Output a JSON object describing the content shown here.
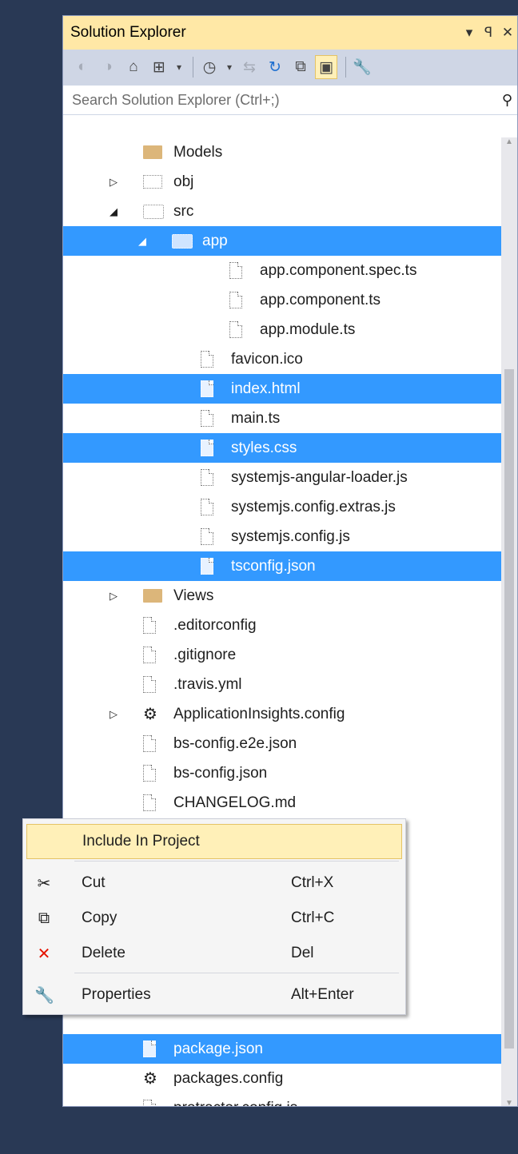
{
  "window": {
    "title": "Solution Explorer",
    "dropdown_glyph": "▾",
    "pin_glyph": "ꟼ",
    "close_glyph": "✕"
  },
  "toolbar": {
    "icons": [
      "back-icon",
      "forward-icon",
      "home-icon",
      "switch-views-icon",
      "dropdown-icon",
      "pending-changes-filter-icon",
      "dropdown-icon",
      "sync-with-active-document-icon",
      "refresh-icon",
      "collapse-all-icon",
      "show-all-files-icon",
      "properties-icon"
    ]
  },
  "search": {
    "placeholder": "Search Solution Explorer (Ctrl+;)"
  },
  "tree": {
    "rows": [
      {
        "label": "Models",
        "icon": "folder-icon",
        "arrow": "",
        "level": 2,
        "selected": false
      },
      {
        "label": "obj",
        "icon": "folder-excluded-icon",
        "arrow": "▷",
        "level": 2,
        "selected": false
      },
      {
        "label": "src",
        "icon": "folder-open-excluded-icon",
        "arrow": "◢",
        "level": 2,
        "selected": false
      },
      {
        "label": "app",
        "icon": "folder-open-excluded-icon",
        "arrow": "◢",
        "level": 3,
        "selected": true
      },
      {
        "label": "app.component.spec.ts",
        "icon": "file-excluded-icon",
        "arrow": "",
        "level": 5,
        "selected": false
      },
      {
        "label": "app.component.ts",
        "icon": "file-excluded-icon",
        "arrow": "",
        "level": 5,
        "selected": false
      },
      {
        "label": "app.module.ts",
        "icon": "file-excluded-icon",
        "arrow": "",
        "level": 5,
        "selected": false
      },
      {
        "label": "favicon.ico",
        "icon": "file-excluded-icon",
        "arrow": "",
        "level": 4,
        "selected": false
      },
      {
        "label": "index.html",
        "icon": "file-excluded-icon",
        "arrow": "",
        "level": 4,
        "selected": true
      },
      {
        "label": "main.ts",
        "icon": "file-excluded-icon",
        "arrow": "",
        "level": 4,
        "selected": false
      },
      {
        "label": "styles.css",
        "icon": "file-excluded-icon",
        "arrow": "",
        "level": 4,
        "selected": true
      },
      {
        "label": "systemjs-angular-loader.js",
        "icon": "file-excluded-icon",
        "arrow": "",
        "level": 4,
        "selected": false
      },
      {
        "label": "systemjs.config.extras.js",
        "icon": "file-excluded-icon",
        "arrow": "",
        "level": 4,
        "selected": false
      },
      {
        "label": "systemjs.config.js",
        "icon": "file-excluded-icon",
        "arrow": "",
        "level": 4,
        "selected": false
      },
      {
        "label": "tsconfig.json",
        "icon": "file-excluded-icon",
        "arrow": "",
        "level": 4,
        "selected": true
      },
      {
        "label": "Views",
        "icon": "folder-icon",
        "arrow": "▷",
        "level": 2,
        "selected": false
      },
      {
        "label": ".editorconfig",
        "icon": "file-excluded-icon",
        "arrow": "",
        "level": 2,
        "selected": false
      },
      {
        "label": ".gitignore",
        "icon": "file-excluded-icon",
        "arrow": "",
        "level": 2,
        "selected": false
      },
      {
        "label": ".travis.yml",
        "icon": "file-excluded-icon",
        "arrow": "",
        "level": 2,
        "selected": false
      },
      {
        "label": "ApplicationInsights.config",
        "icon": "config-file-icon",
        "arrow": "▷",
        "level": 2,
        "selected": false
      },
      {
        "label": "bs-config.e2e.json",
        "icon": "file-excluded-icon",
        "arrow": "",
        "level": 2,
        "selected": false
      },
      {
        "label": "bs-config.json",
        "icon": "file-excluded-icon",
        "arrow": "",
        "level": 2,
        "selected": false
      },
      {
        "label": "CHANGELOG.md",
        "icon": "file-excluded-icon",
        "arrow": "",
        "level": 2,
        "selected": false
      }
    ],
    "bottom_rows": [
      {
        "label": "package.json",
        "icon": "file-excluded-icon",
        "arrow": "",
        "level": 2,
        "selected": true
      },
      {
        "label": "packages.config",
        "icon": "config-file-icon",
        "arrow": "",
        "level": 2,
        "selected": false
      },
      {
        "label": "protractor.config.js",
        "icon": "file-excluded-icon",
        "arrow": "",
        "level": 2,
        "selected": false
      }
    ]
  },
  "context_menu": {
    "items": [
      {
        "label": "Include In Project",
        "shortcut": "",
        "icon": "",
        "highlighted": true
      },
      {
        "label": "Cut",
        "shortcut": "Ctrl+X",
        "icon": "scissors-icon",
        "highlighted": false
      },
      {
        "label": "Copy",
        "shortcut": "Ctrl+C",
        "icon": "copy-icon",
        "highlighted": false
      },
      {
        "label": "Delete",
        "shortcut": "Del",
        "icon": "delete-icon",
        "highlighted": false
      },
      {
        "label": "Properties",
        "shortcut": "Alt+Enter",
        "icon": "wrench-icon",
        "highlighted": false
      }
    ]
  },
  "colors": {
    "selection": "#3399ff",
    "title_active": "#ffe8a6",
    "frame": "#293955",
    "delete_red": "#e51400"
  }
}
